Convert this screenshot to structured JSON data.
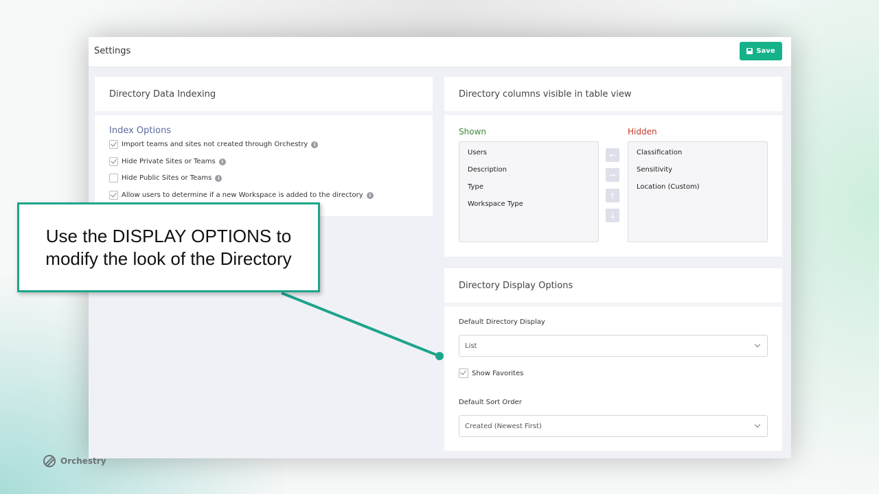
{
  "window": {
    "title": "Settings",
    "save_label": "Save"
  },
  "indexing": {
    "card_title": "Directory Data Indexing",
    "section_title": "Index Options",
    "options": [
      {
        "label": "Import teams and sites not created through Orchestry",
        "checked": true
      },
      {
        "label": "Hide Private Sites or Teams",
        "checked": true
      },
      {
        "label": "Hide Public Sites or Teams",
        "checked": false
      },
      {
        "label": "Allow users to determine if a new Workspace is added to the directory",
        "checked": true
      }
    ]
  },
  "columns": {
    "card_title": "Directory columns visible in table view",
    "shown_label": "Shown",
    "hidden_label": "Hidden",
    "shown_items": [
      "Users",
      "Description",
      "Type",
      "Workspace Type"
    ],
    "hidden_items": [
      "Classification",
      "Sensitivity",
      "Location (Custom)"
    ],
    "arrow_icons": [
      "arrow-left-icon",
      "arrow-right-icon",
      "arrow-up-icon",
      "arrow-down-icon"
    ]
  },
  "display": {
    "card_title": "Directory Display Options",
    "default_display_label": "Default Directory Display",
    "default_display_value": "List",
    "show_favorites_label": "Show Favorites",
    "show_favorites_checked": true,
    "sort_order_label": "Default Sort Order",
    "sort_order_value": "Created (Newest First)"
  },
  "callout": {
    "line1": "Use the DISPLAY OPTIONS to",
    "line2": "modify the look of the Directory"
  },
  "brand": {
    "name": "Orchestry"
  },
  "colors": {
    "accent": "#15b28a",
    "callout_border": "#1da58b",
    "shown": "#3c8a3c",
    "hidden": "#c0392b"
  }
}
